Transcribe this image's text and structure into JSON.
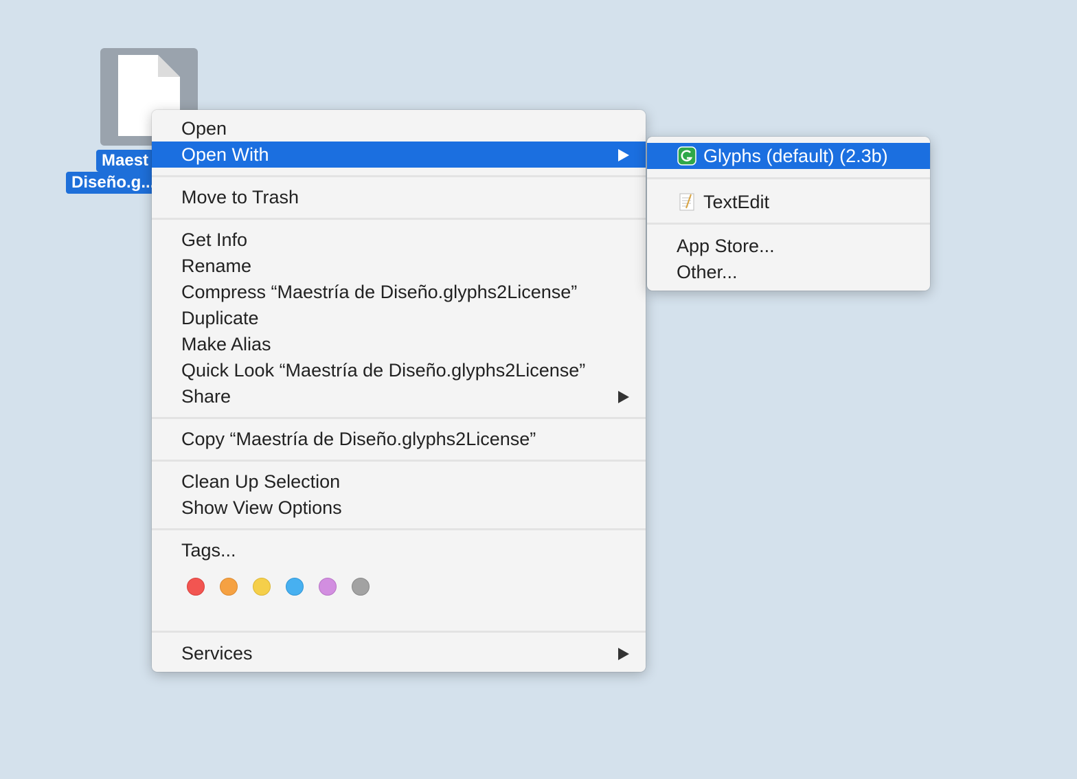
{
  "desktop_file": {
    "label_line1": "Maest",
    "label_line2": "Diseño.g..."
  },
  "context_menu": {
    "open": "Open",
    "open_with": "Open With",
    "move_to_trash": "Move to Trash",
    "get_info": "Get Info",
    "rename": "Rename",
    "compress": "Compress “Maestría de Diseño.glyphs2License”",
    "duplicate": "Duplicate",
    "make_alias": "Make Alias",
    "quick_look": "Quick Look “Maestría de Diseño.glyphs2License”",
    "share": "Share",
    "copy": "Copy “Maestría de Diseño.glyphs2License”",
    "clean_up": "Clean Up Selection",
    "show_view_options": "Show View Options",
    "tags": "Tags...",
    "services": "Services",
    "tag_colors": [
      {
        "name": "red",
        "fill": "#f25551",
        "border": "#d8403c"
      },
      {
        "name": "orange",
        "fill": "#f5a142",
        "border": "#dc8a30"
      },
      {
        "name": "yellow",
        "fill": "#f5cf4a",
        "border": "#dcb635"
      },
      {
        "name": "blue",
        "fill": "#47b0f0",
        "border": "#3096d6"
      },
      {
        "name": "purple",
        "fill": "#d28ee0",
        "border": "#b874c6"
      },
      {
        "name": "gray",
        "fill": "#a2a2a2",
        "border": "#888888"
      }
    ]
  },
  "open_with_submenu": {
    "glyphs": "Glyphs (default) (2.3b)",
    "textedit": "TextEdit",
    "app_store": "App Store...",
    "other": "Other..."
  },
  "colors": {
    "selection": "#1b6fe0",
    "desktop": "#d4e1ec"
  }
}
